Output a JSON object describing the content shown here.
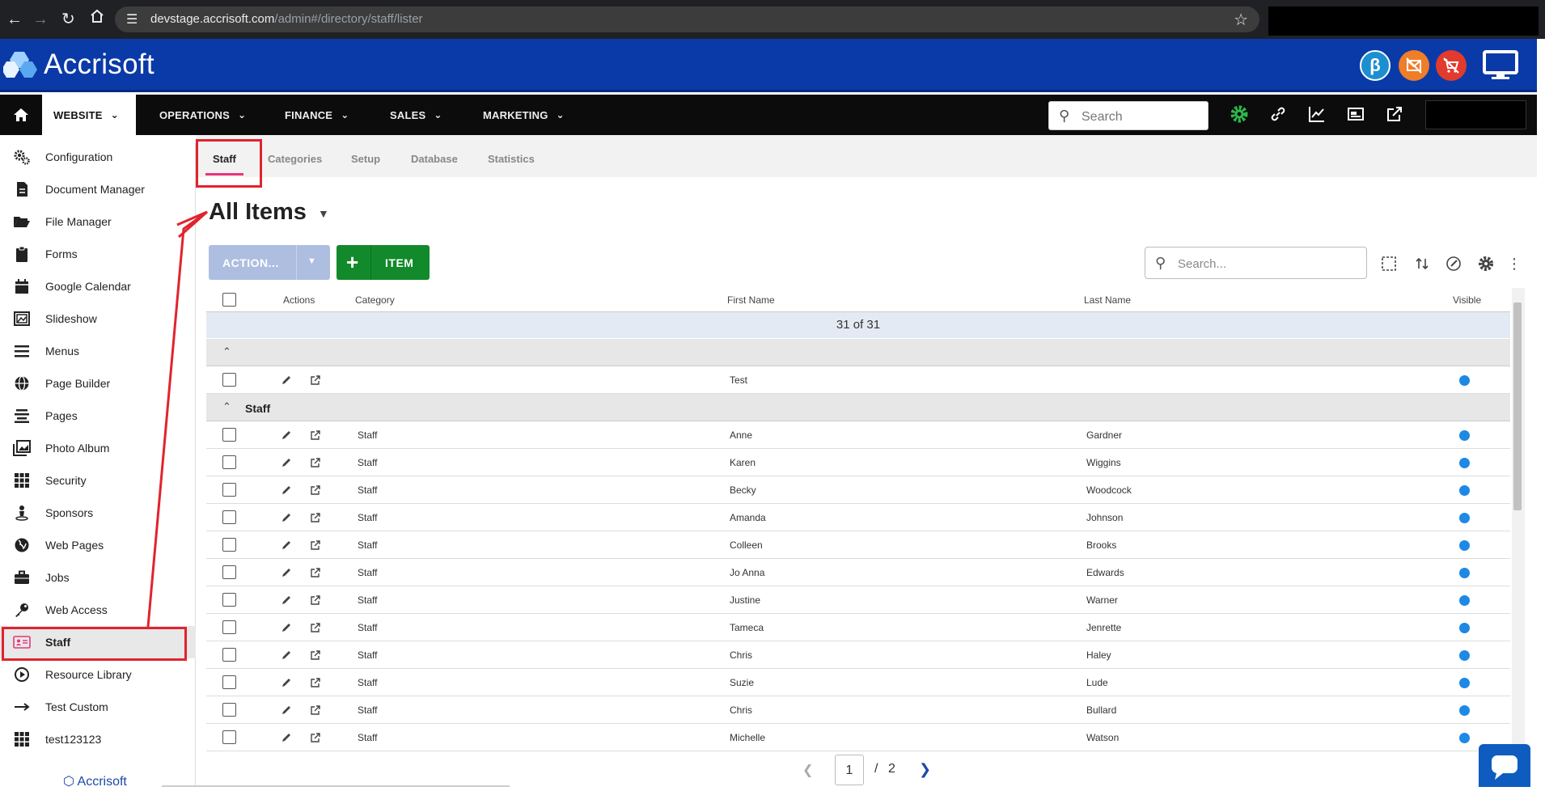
{
  "browser": {
    "url_host": "devstage.accrisoft.com",
    "url_path": "/admin#/directory/staff/lister"
  },
  "app": {
    "brand": "Accrisoft",
    "footer_brand": "Accrisoft"
  },
  "header_buttons": [
    {
      "icon": "beta-icon",
      "color": "#1d8fd1",
      "glyph": "β"
    },
    {
      "icon": "mail-off-icon",
      "color": "#f07d28"
    },
    {
      "icon": "cart-off-icon",
      "color": "#e23a2d"
    },
    {
      "icon": "monitor-icon"
    }
  ],
  "topnav": {
    "menus": [
      "WEBSITE",
      "OPERATIONS",
      "FINANCE",
      "SALES",
      "MARKETING"
    ],
    "search_placeholder": "Search"
  },
  "sidebar": {
    "items": [
      {
        "label": "Configuration",
        "icon": "gears-icon"
      },
      {
        "label": "Document Manager",
        "icon": "document-icon"
      },
      {
        "label": "File Manager",
        "icon": "folder-open-icon"
      },
      {
        "label": "Forms",
        "icon": "clipboard-icon"
      },
      {
        "label": "Google Calendar",
        "icon": "calendar-icon"
      },
      {
        "label": "Slideshow",
        "icon": "slideshow-icon"
      },
      {
        "label": "Menus",
        "icon": "menu-lines-icon"
      },
      {
        "label": "Page Builder",
        "icon": "globe-icon"
      },
      {
        "label": "Pages",
        "icon": "align-center-icon"
      },
      {
        "label": "Photo Album",
        "icon": "photo-icon"
      },
      {
        "label": "Security",
        "icon": "grid-icon"
      },
      {
        "label": "Sponsors",
        "icon": "person-pin-icon"
      },
      {
        "label": "Web Pages",
        "icon": "globe-africa-icon"
      },
      {
        "label": "Jobs",
        "icon": "briefcase-icon"
      },
      {
        "label": "Web Access",
        "icon": "key-icon"
      },
      {
        "label": "Staff",
        "icon": "id-card-icon",
        "active": true
      },
      {
        "label": "Resource Library",
        "icon": "play-circle-icon"
      },
      {
        "label": "Test Custom",
        "icon": "arrow-right-icon"
      },
      {
        "label": "test123123",
        "icon": "grid-icon"
      }
    ]
  },
  "subtabs": [
    "Staff",
    "Categories",
    "Setup",
    "Database",
    "Statistics"
  ],
  "page": {
    "title": "All Items",
    "action_label": "ACTION...",
    "item_label": "ITEM",
    "search_placeholder": "Search...",
    "accent_pink": "#e5367a",
    "accent_green": "#128a2c"
  },
  "table": {
    "columns": [
      "Actions",
      "Category",
      "First Name",
      "Last Name",
      "Visible"
    ],
    "count": "31 of 31",
    "ungrouped_rows": [
      {
        "category": "",
        "first": "Test",
        "last": ""
      }
    ],
    "group_label": "Staff",
    "rows": [
      {
        "category": "Staff",
        "first": "Anne",
        "last": "Gardner"
      },
      {
        "category": "Staff",
        "first": "Karen",
        "last": "Wiggins"
      },
      {
        "category": "Staff",
        "first": "Becky",
        "last": "Woodcock"
      },
      {
        "category": "Staff",
        "first": "Amanda",
        "last": "Johnson"
      },
      {
        "category": "Staff",
        "first": "Colleen",
        "last": "Brooks"
      },
      {
        "category": "Staff",
        "first": "Jo Anna",
        "last": "Edwards"
      },
      {
        "category": "Staff",
        "first": "Justine",
        "last": "Warner"
      },
      {
        "category": "Staff",
        "first": "Tameca",
        "last": "Jenrette"
      },
      {
        "category": "Staff",
        "first": "Chris",
        "last": "Haley"
      },
      {
        "category": "Staff",
        "first": "Suzie",
        "last": "Lude"
      },
      {
        "category": "Staff",
        "first": "Chris",
        "last": "Bullard"
      },
      {
        "category": "Staff",
        "first": "Michelle",
        "last": "Watson"
      }
    ]
  },
  "pager": {
    "current": "1",
    "separator": "/",
    "total": "2"
  }
}
